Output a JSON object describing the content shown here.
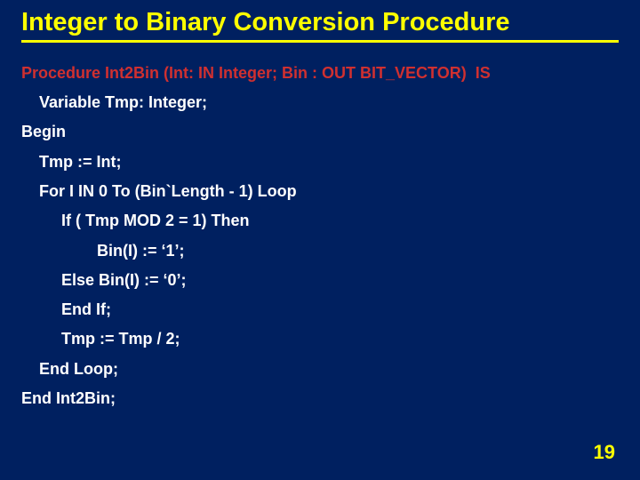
{
  "title": "Integer to Binary Conversion Procedure",
  "lines": {
    "l0": "Procedure Int2Bin (Int: IN Integer; Bin : OUT BIT_VECTOR)  IS",
    "l1": "    Variable Tmp: Integer;",
    "l2": "Begin",
    "l3": "    Tmp := Int;",
    "l4": "    For I IN 0 To (Bin`Length - 1) Loop",
    "l5": "         If ( Tmp MOD 2 = 1) Then",
    "l6": "                 Bin(I) := ‘1’;",
    "l7": "         Else Bin(I) := ‘0’;",
    "l8": "         End If;",
    "l9": "         Tmp := Tmp / 2;",
    "l10": "    End Loop;",
    "l11": "End Int2Bin;"
  },
  "pageNumber": "19"
}
